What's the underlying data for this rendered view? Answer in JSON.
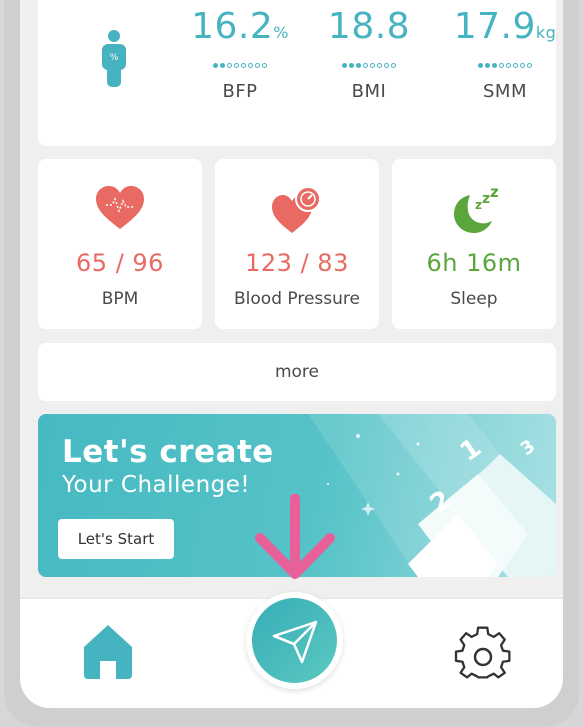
{
  "metrics": [
    {
      "value": "16.2",
      "unit": "%",
      "label": "BFP",
      "dots_filled": 2,
      "dots_total": 8
    },
    {
      "value": "18.8",
      "unit": "",
      "label": "BMI",
      "dots_filled": 3,
      "dots_total": 8
    },
    {
      "value": "17.9",
      "unit": "kg",
      "label": "SMM",
      "dots_filled": 3,
      "dots_total": 8
    }
  ],
  "vitals": {
    "heart_rate": {
      "value": "65 / 96",
      "label": "BPM",
      "color": "#e86a62"
    },
    "blood_pressure": {
      "value": "123 / 83",
      "label": "Blood Pressure",
      "color": "#e86a62"
    },
    "sleep": {
      "value": "6h 16m",
      "label": "Sleep",
      "color": "#5aa63d"
    }
  },
  "more_label": "more",
  "banner": {
    "title": "Let's create",
    "subtitle": "Your Challenge!",
    "button_label": "Let's Start",
    "steps": [
      "1",
      "2",
      "3"
    ]
  },
  "nav": {
    "icons": [
      "home-icon",
      "send-icon",
      "gear-icon"
    ]
  },
  "colors": {
    "accent": "#46b3c0",
    "heart": "#e86a62",
    "sleep": "#5aa63d",
    "hint_arrow": "#e8609a"
  }
}
